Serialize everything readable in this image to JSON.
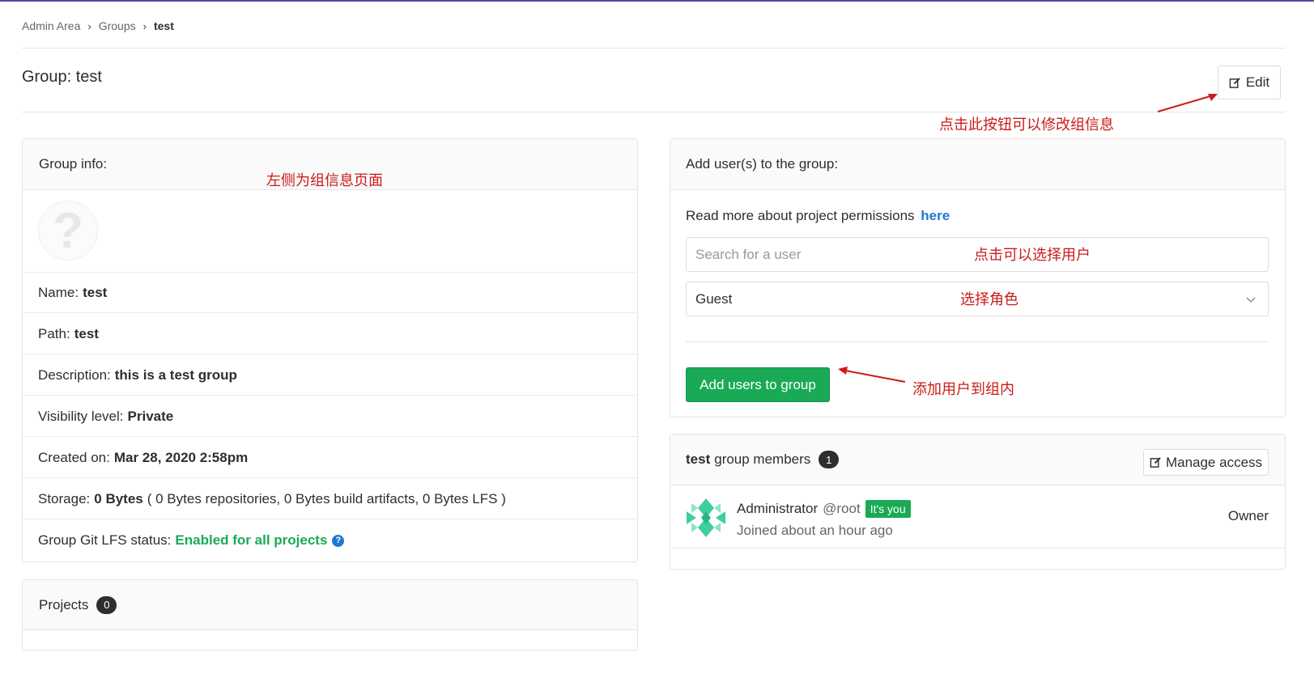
{
  "breadcrumb": {
    "items": [
      "Admin Area",
      "Groups"
    ],
    "current": "test"
  },
  "page": {
    "title": "Group: test",
    "edit_label": "Edit"
  },
  "group_info": {
    "header": "Group info:",
    "name_label": "Name:",
    "name_value": "test",
    "path_label": "Path:",
    "path_value": "test",
    "description_label": "Description:",
    "description_value": "this is a test group",
    "visibility_label": "Visibility level:",
    "visibility_value": "Private",
    "created_label": "Created on:",
    "created_value": "Mar 28, 2020 2:58pm",
    "storage_label": "Storage:",
    "storage_value": "0 Bytes",
    "storage_detail": "( 0 Bytes repositories, 0 Bytes build artifacts, 0 Bytes LFS )",
    "lfs_label": "Group Git LFS status:",
    "lfs_value": "Enabled for all projects"
  },
  "projects": {
    "header": "Projects",
    "count": "0"
  },
  "add_users": {
    "header": "Add user(s) to the group:",
    "permissions_text": "Read more about project permissions",
    "permissions_link": "here",
    "search_placeholder": "Search for a user",
    "role_selected": "Guest",
    "submit_label": "Add users to group"
  },
  "members": {
    "group_name": "test",
    "header_suffix": "group members",
    "count": "1",
    "manage_label": "Manage access",
    "list": [
      {
        "name": "Administrator",
        "username": "@root",
        "badge": "It's you",
        "joined": "Joined about an hour ago",
        "role": "Owner"
      }
    ]
  },
  "annotations": {
    "edit_note": "点击此按钮可以修改组信息",
    "left_note": "左侧为组信息页面",
    "search_note": "点击可以选择用户",
    "role_note": "选择角色",
    "add_note": "添加用户到组内"
  },
  "colors": {
    "green": "#1aaa55",
    "link": "#1f78d1",
    "annotation": "#cc1a1a",
    "badge_dark": "#2e2e2e"
  }
}
